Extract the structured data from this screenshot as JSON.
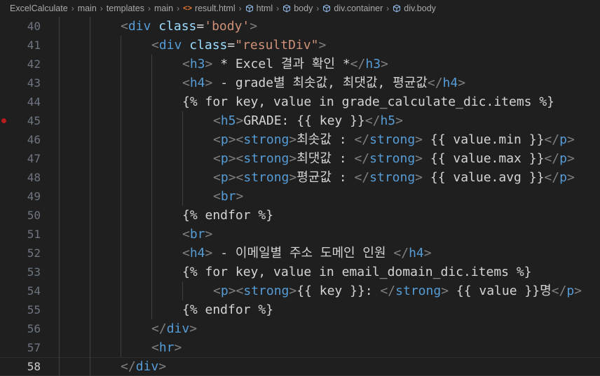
{
  "breadcrumb": [
    {
      "label": "ExcelCalculate",
      "icon": null
    },
    {
      "label": "main",
      "icon": null
    },
    {
      "label": "templates",
      "icon": null
    },
    {
      "label": "main",
      "icon": null
    },
    {
      "label": "result.html",
      "icon": "html-file-icon"
    },
    {
      "label": "html",
      "icon": "element-cube-icon"
    },
    {
      "label": "body",
      "icon": "element-cube-icon"
    },
    {
      "label": "div.container",
      "icon": "element-cube-icon"
    },
    {
      "label": "div.body",
      "icon": "element-cube-icon"
    }
  ],
  "colors": {
    "background": "#1f1f1f",
    "tag": "#569cd6",
    "attribute": "#9cdcfe",
    "string": "#ce9178",
    "punctuation": "#808080",
    "text": "#d4d4d4",
    "line_number": "#6e7681",
    "breakpoint": "#b51c1c"
  },
  "editor": {
    "current_line": 58,
    "breakpoint_line": 45,
    "lines": [
      {
        "num": "40",
        "indent": 2,
        "tokens": [
          [
            "punc",
            "<"
          ],
          [
            "tag",
            "div"
          ],
          [
            "text",
            " "
          ],
          [
            "attr",
            "class"
          ],
          [
            "text",
            "="
          ],
          [
            "str",
            "'body'"
          ],
          [
            "punc",
            ">"
          ]
        ]
      },
      {
        "num": "41",
        "indent": 3,
        "tokens": [
          [
            "punc",
            "<"
          ],
          [
            "tag",
            "div"
          ],
          [
            "text",
            " "
          ],
          [
            "attr",
            "class"
          ],
          [
            "text",
            "="
          ],
          [
            "str",
            "\"resultDiv\""
          ],
          [
            "punc",
            ">"
          ]
        ]
      },
      {
        "num": "42",
        "indent": 4,
        "tokens": [
          [
            "punc",
            "<"
          ],
          [
            "tag",
            "h3"
          ],
          [
            "punc",
            ">"
          ],
          [
            "text",
            " * Excel 결과 확인 *"
          ],
          [
            "punc",
            "</"
          ],
          [
            "tag",
            "h3"
          ],
          [
            "punc",
            ">"
          ]
        ]
      },
      {
        "num": "43",
        "indent": 4,
        "tokens": [
          [
            "punc",
            "<"
          ],
          [
            "tag",
            "h4"
          ],
          [
            "punc",
            ">"
          ],
          [
            "text",
            " - grade별 최솟값, 최댓값, 평균값"
          ],
          [
            "punc",
            "</"
          ],
          [
            "tag",
            "h4"
          ],
          [
            "punc",
            ">"
          ]
        ]
      },
      {
        "num": "44",
        "indent": 4,
        "tokens": [
          [
            "text",
            "{% for key, value in grade_calculate_dic.items %}"
          ]
        ]
      },
      {
        "num": "45",
        "indent": 5,
        "tokens": [
          [
            "punc",
            "<"
          ],
          [
            "tag",
            "h5"
          ],
          [
            "punc",
            ">"
          ],
          [
            "text",
            "GRADE: {{ key }}"
          ],
          [
            "punc",
            "</"
          ],
          [
            "tag",
            "h5"
          ],
          [
            "punc",
            ">"
          ]
        ]
      },
      {
        "num": "46",
        "indent": 5,
        "tokens": [
          [
            "punc",
            "<"
          ],
          [
            "tag",
            "p"
          ],
          [
            "punc",
            "><"
          ],
          [
            "tag",
            "strong"
          ],
          [
            "punc",
            ">"
          ],
          [
            "text",
            "최솟값 : "
          ],
          [
            "punc",
            "</"
          ],
          [
            "tag",
            "strong"
          ],
          [
            "punc",
            ">"
          ],
          [
            "text",
            " {{ value.min }}"
          ],
          [
            "punc",
            "</"
          ],
          [
            "tag",
            "p"
          ],
          [
            "punc",
            ">"
          ]
        ]
      },
      {
        "num": "47",
        "indent": 5,
        "tokens": [
          [
            "punc",
            "<"
          ],
          [
            "tag",
            "p"
          ],
          [
            "punc",
            "><"
          ],
          [
            "tag",
            "strong"
          ],
          [
            "punc",
            ">"
          ],
          [
            "text",
            "최댓값 : "
          ],
          [
            "punc",
            "</"
          ],
          [
            "tag",
            "strong"
          ],
          [
            "punc",
            ">"
          ],
          [
            "text",
            " {{ value.max }}"
          ],
          [
            "punc",
            "</"
          ],
          [
            "tag",
            "p"
          ],
          [
            "punc",
            ">"
          ]
        ]
      },
      {
        "num": "48",
        "indent": 5,
        "tokens": [
          [
            "punc",
            "<"
          ],
          [
            "tag",
            "p"
          ],
          [
            "punc",
            "><"
          ],
          [
            "tag",
            "strong"
          ],
          [
            "punc",
            ">"
          ],
          [
            "text",
            "평균값 : "
          ],
          [
            "punc",
            "</"
          ],
          [
            "tag",
            "strong"
          ],
          [
            "punc",
            ">"
          ],
          [
            "text",
            " {{ value.avg }}"
          ],
          [
            "punc",
            "</"
          ],
          [
            "tag",
            "p"
          ],
          [
            "punc",
            ">"
          ]
        ]
      },
      {
        "num": "49",
        "indent": 5,
        "tokens": [
          [
            "punc",
            "<"
          ],
          [
            "tag",
            "br"
          ],
          [
            "punc",
            ">"
          ]
        ]
      },
      {
        "num": "50",
        "indent": 4,
        "tokens": [
          [
            "text",
            "{% endfor %}"
          ]
        ]
      },
      {
        "num": "51",
        "indent": 4,
        "tokens": [
          [
            "punc",
            "<"
          ],
          [
            "tag",
            "br"
          ],
          [
            "punc",
            ">"
          ]
        ]
      },
      {
        "num": "52",
        "indent": 4,
        "tokens": [
          [
            "punc",
            "<"
          ],
          [
            "tag",
            "h4"
          ],
          [
            "punc",
            ">"
          ],
          [
            "text",
            " - 이메일별 주소 도메인 인원 "
          ],
          [
            "punc",
            "</"
          ],
          [
            "tag",
            "h4"
          ],
          [
            "punc",
            ">"
          ]
        ]
      },
      {
        "num": "53",
        "indent": 4,
        "tokens": [
          [
            "text",
            "{% for key, value in email_domain_dic.items %}"
          ]
        ]
      },
      {
        "num": "54",
        "indent": 5,
        "tokens": [
          [
            "punc",
            "<"
          ],
          [
            "tag",
            "p"
          ],
          [
            "punc",
            "><"
          ],
          [
            "tag",
            "strong"
          ],
          [
            "punc",
            ">"
          ],
          [
            "text",
            "{{ key }}: "
          ],
          [
            "punc",
            "</"
          ],
          [
            "tag",
            "strong"
          ],
          [
            "punc",
            ">"
          ],
          [
            "text",
            " {{ value }}명"
          ],
          [
            "punc",
            "</"
          ],
          [
            "tag",
            "p"
          ],
          [
            "punc",
            ">"
          ]
        ]
      },
      {
        "num": "55",
        "indent": 4,
        "tokens": [
          [
            "text",
            "{% endfor %}"
          ]
        ]
      },
      {
        "num": "56",
        "indent": 3,
        "tokens": [
          [
            "punc",
            "</"
          ],
          [
            "tag",
            "div"
          ],
          [
            "punc",
            ">"
          ]
        ]
      },
      {
        "num": "57",
        "indent": 3,
        "tokens": [
          [
            "punc",
            "<"
          ],
          [
            "tag",
            "hr"
          ],
          [
            "punc",
            ">"
          ]
        ]
      },
      {
        "num": "58",
        "indent": 2,
        "tokens": [
          [
            "punc",
            "</"
          ],
          [
            "tag",
            "div"
          ],
          [
            "punc",
            ">"
          ]
        ]
      }
    ]
  }
}
